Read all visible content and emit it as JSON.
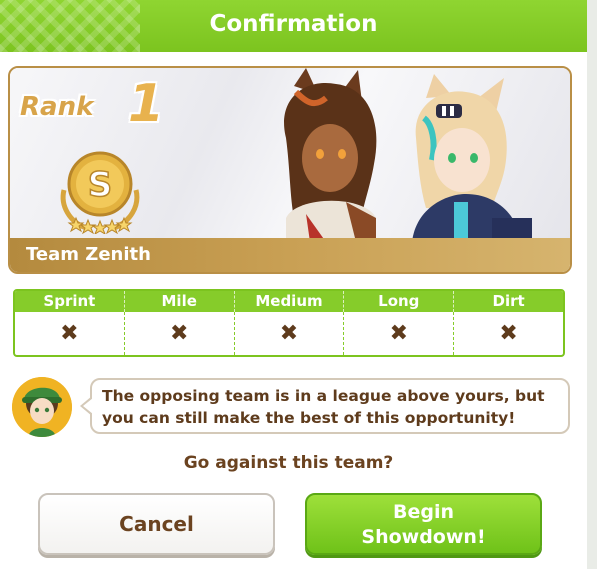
{
  "dialog": {
    "title": "Confirmation"
  },
  "banner": {
    "rank_label": "Rank",
    "rank_value": "1",
    "medal_letter": "S",
    "team_name": "Team Zenith"
  },
  "aptitudes": {
    "headers": [
      "Sprint",
      "Mile",
      "Medium",
      "Long",
      "Dirt"
    ],
    "values": [
      "✖",
      "✖",
      "✖",
      "✖",
      "✖"
    ]
  },
  "message": {
    "text": "The opposing team is in a league above yours, but you can still make the best of this opportunity!"
  },
  "question": "Go against this team?",
  "buttons": {
    "cancel": "Cancel",
    "begin_line1": "Begin",
    "begin_line2": "Showdown!"
  },
  "colors": {
    "accent_green": "#7cc41f",
    "brown_text": "#5e3b1c",
    "gold": "#c9a054"
  },
  "icons": {
    "medal": "gold-s-rank-medal-icon",
    "mark": "cross-mark-icon"
  }
}
